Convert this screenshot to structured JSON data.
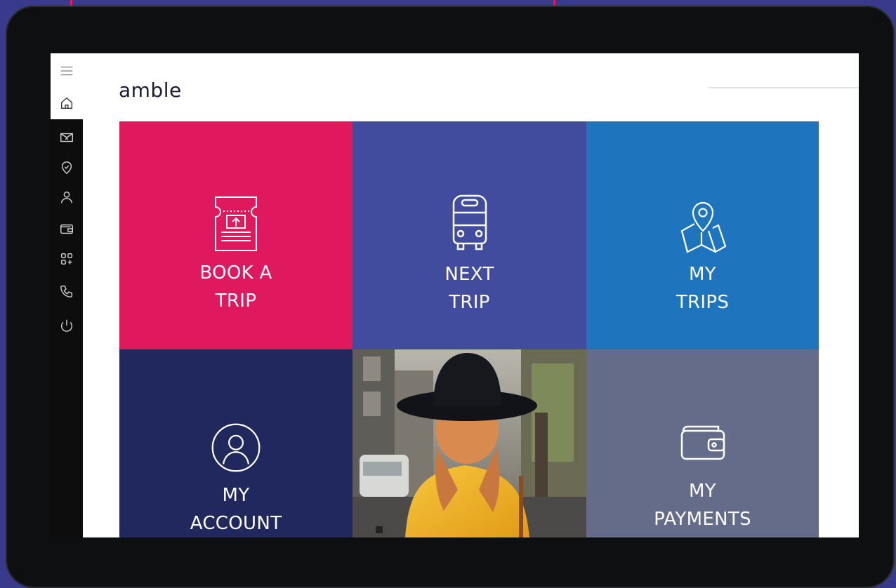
{
  "app": {
    "logo": "amble"
  },
  "colors": {
    "background": "#3a3a8c",
    "book_tile": "#e0195f",
    "next_tile": "#414c9f",
    "trips_tile": "#1f74be",
    "account_tile": "#21285e",
    "payments_tile": "#646c8a",
    "sidebar_dark": "#0d0d0d"
  },
  "sidebar": {
    "items": [
      {
        "icon": "menu-icon"
      },
      {
        "icon": "home-icon"
      },
      {
        "icon": "mail-icon"
      },
      {
        "icon": "location-icon"
      },
      {
        "icon": "user-icon"
      },
      {
        "icon": "wallet-icon"
      },
      {
        "icon": "apps-icon"
      },
      {
        "icon": "phone-icon"
      },
      {
        "icon": "power-icon"
      }
    ]
  },
  "tiles": {
    "book_trip": {
      "label": "BOOK A\nTRIP",
      "icon": "ticket-icon"
    },
    "next_trip": {
      "label": "NEXT\nTRIP",
      "icon": "bus-icon"
    },
    "my_trips": {
      "label": "MY\nTRIPS",
      "icon": "map-pin-icon"
    },
    "my_account": {
      "label": "MY\nACCOUNT",
      "icon": "account-icon"
    },
    "photo": {
      "description_icon": "photo-woman-hat"
    },
    "my_payments": {
      "label": "MY\nPAYMENTS",
      "icon": "wallet-icon"
    }
  }
}
